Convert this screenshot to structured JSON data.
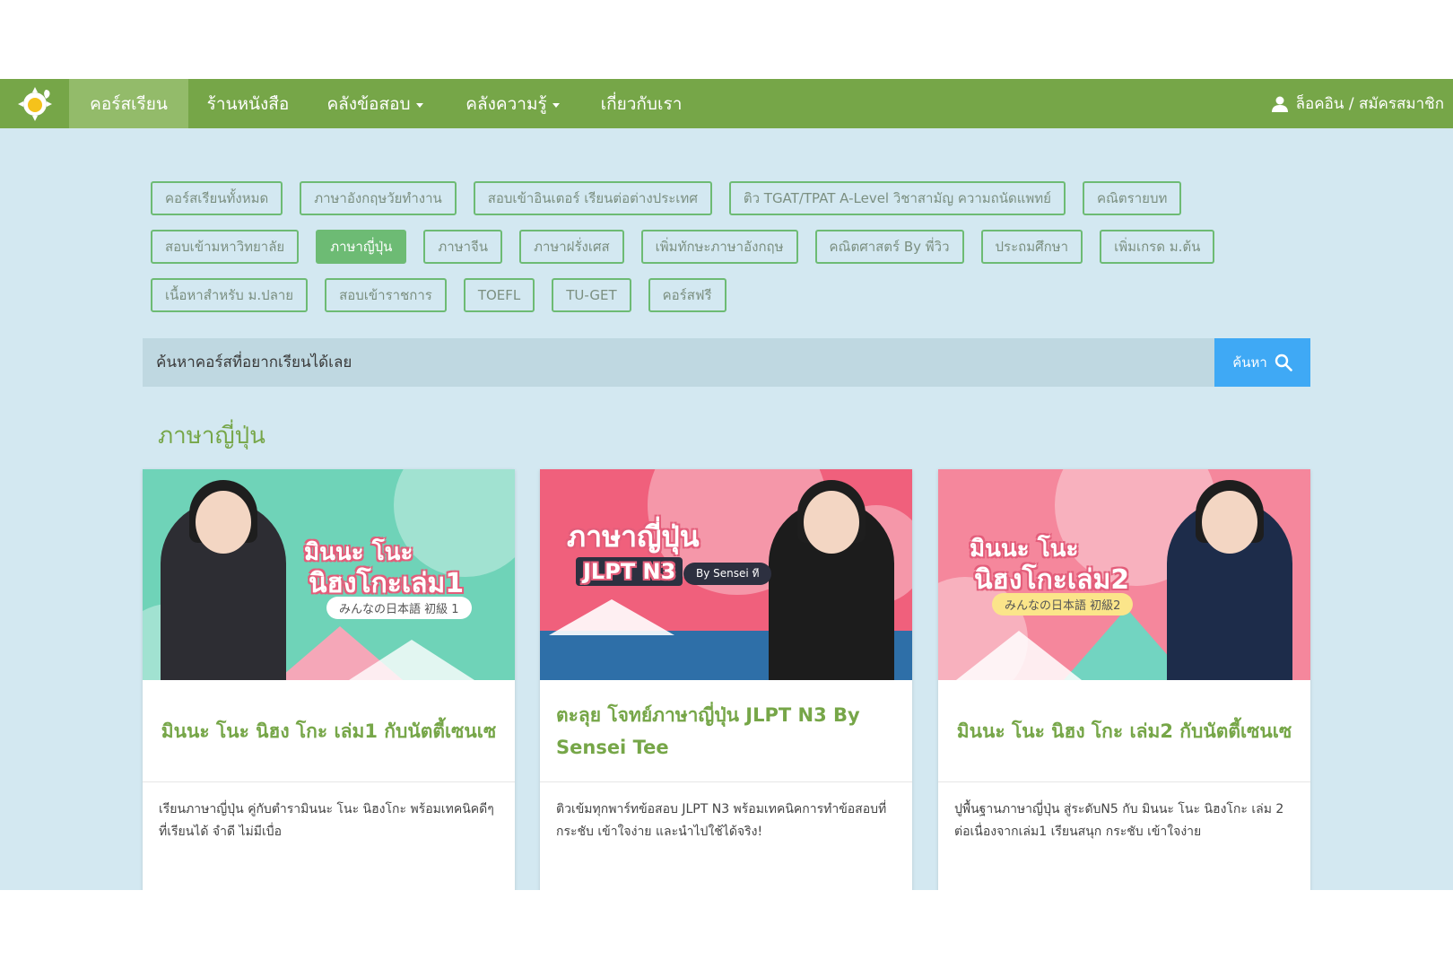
{
  "nav": {
    "logo_icon": "sun-leaf-logo-icon",
    "items": [
      {
        "label": "คอร์สเรียน",
        "active": true
      },
      {
        "label": "ร้านหนังสือ"
      },
      {
        "label": "คลังข้อสอบ",
        "dropdown": true
      },
      {
        "label": "คลังความรู้",
        "dropdown": true
      },
      {
        "label": "เกี่ยวกับเรา"
      }
    ],
    "login_label": "ล็อคอิน / สมัครสมาชิก",
    "login_icon": "user-icon"
  },
  "categories": [
    [
      "คอร์สเรียนทั้งหมด",
      "ภาษาอังกฤษวัยทำงาน",
      "สอบเข้าอินเตอร์ เรียนต่อต่างประเทศ",
      "ติว TGAT/TPAT A-Level วิชาสามัญ ความถนัดแพทย์",
      "คณิตรายบท"
    ],
    [
      "สอบเข้ามหาวิทยาลัย",
      "ภาษาญี่ปุ่น",
      "ภาษาจีน",
      "ภาษาฝรั่งเศส",
      "เพิ่มทักษะภาษาอังกฤษ",
      "คณิตศาสตร์ By พี่วิว",
      "ประถมศึกษา",
      "เพิ่มเกรด ม.ต้น"
    ],
    [
      "เนื้อหาสำหรับ ม.ปลาย",
      "สอบเข้าราชการ",
      "TOEFL",
      "TU-GET",
      "คอร์สฟรี"
    ]
  ],
  "active_category": "ภาษาญี่ปุ่น",
  "search": {
    "placeholder": "ค้นหาคอร์สที่อยากเรียนได้เลย",
    "button_label": "ค้นหา",
    "icon": "search-icon"
  },
  "section_title": "ภาษาญี่ปุ่น",
  "courses": [
    {
      "title": "มินนะ โนะ นิฮง โกะ เล่ม1 กับนัตตี้เซนเซ",
      "description": "เรียนภาษาญี่ปุ่น คู่กับตำรามินนะ โนะ นิฮงโกะ พร้อมเทคนิคดีๆที่เรียนได้ จำดี ไม่มีเบื่อ",
      "thumb_title_1": "มินนะ โนะ",
      "thumb_title_2": "นิฮงโกะเล่ม1",
      "thumb_sub": "みんなの日本語 初級 1",
      "thumb_bg": "#6fd3b8"
    },
    {
      "title": "ตะลุย โจทย์ภาษาญี่ปุ่น JLPT N3 By Sensei Tee",
      "description": "ติวเข้มทุกพาร์ทข้อสอบ JLPT N3 พร้อมเทคนิคการทำข้อสอบที่กระชับ เข้าใจง่าย และนำไปใช้ได้จริง!",
      "thumb_title_1": "ภาษาญี่ปุ่น",
      "thumb_title_2": "JLPT N3",
      "thumb_sub": "By Sensei ที",
      "thumb_bg": "#f0607c"
    },
    {
      "title": "มินนะ โนะ นิฮง โกะ เล่ม2 กับนัตตี้เซนเซ",
      "description": "ปูพื้นฐานภาษาญี่ปุ่น สู่ระดับN5 กับ มินนะ โนะ นิฮงโกะ เล่ม 2 ต่อเนื่องจากเล่ม1 เรียนสนุก กระชับ เข้าใจง่าย",
      "thumb_title_1": "มินนะ โนะ",
      "thumb_title_2": "นิฮงโกะเล่ม2",
      "thumb_sub": "みんなの日本語 初級2",
      "thumb_bg": "#f5879c"
    }
  ],
  "colors": {
    "nav_bg": "#76a648",
    "page_bg": "#d3e8f1",
    "category_border": "#6dbb74",
    "search_button": "#3fa9f5",
    "title_green": "#76a648"
  }
}
